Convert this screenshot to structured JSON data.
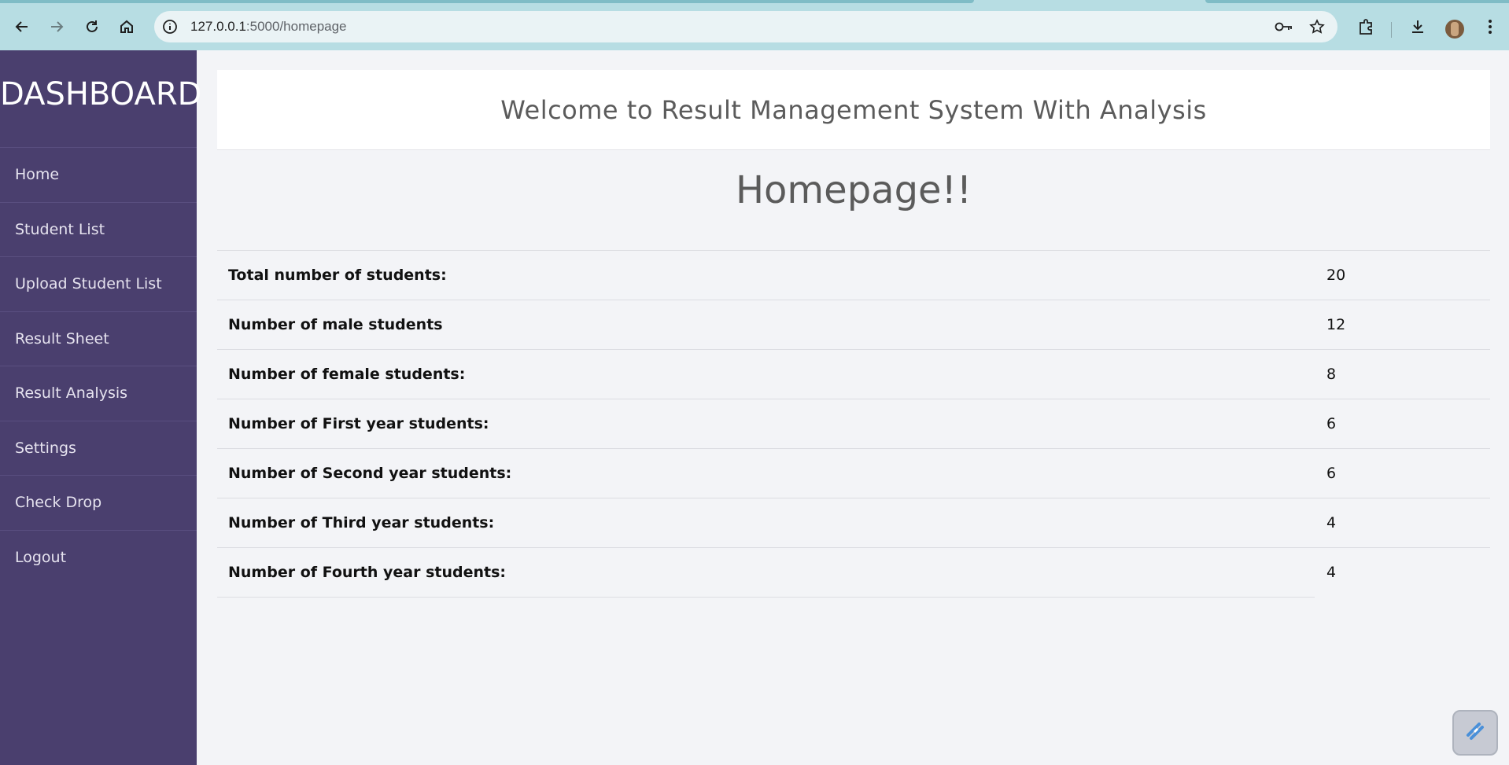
{
  "browser": {
    "url_host": "127.0.0.1",
    "url_path": ":5000/homepage",
    "icons": [
      "back-arrow-icon",
      "forward-arrow-icon",
      "reload-icon",
      "home-icon",
      "site-info-icon",
      "password-key-icon",
      "bookmark-star-icon",
      "extensions-icon",
      "download-icon",
      "avatar",
      "menu-dots-icon"
    ]
  },
  "sidebar": {
    "brand": "DASHBOARD",
    "items": [
      {
        "label": "Home"
      },
      {
        "label": "Student List"
      },
      {
        "label": "Upload Student List"
      },
      {
        "label": "Result Sheet"
      },
      {
        "label": "Result Analysis"
      },
      {
        "label": "Settings"
      },
      {
        "label": "Check Drop"
      },
      {
        "label": "Logout"
      }
    ]
  },
  "header": {
    "title": "Welcome to Result Management System With Analysis"
  },
  "main": {
    "title": "Homepage!!",
    "stats": [
      {
        "label": "Total number of students:",
        "value": "20"
      },
      {
        "label": "Number of male students",
        "value": "12"
      },
      {
        "label": "Number of female students:",
        "value": "8"
      },
      {
        "label": "Number of First year students:",
        "value": "6"
      },
      {
        "label": "Number of Second year students:",
        "value": "6"
      },
      {
        "label": "Number of Third year students:",
        "value": "4"
      },
      {
        "label": "Number of Fourth year students:",
        "value": "4"
      }
    ]
  },
  "colors": {
    "sidebar_bg": "#4a3f6e",
    "page_bg": "#f3f4f7",
    "chrome_bg": "#b7dde3"
  }
}
